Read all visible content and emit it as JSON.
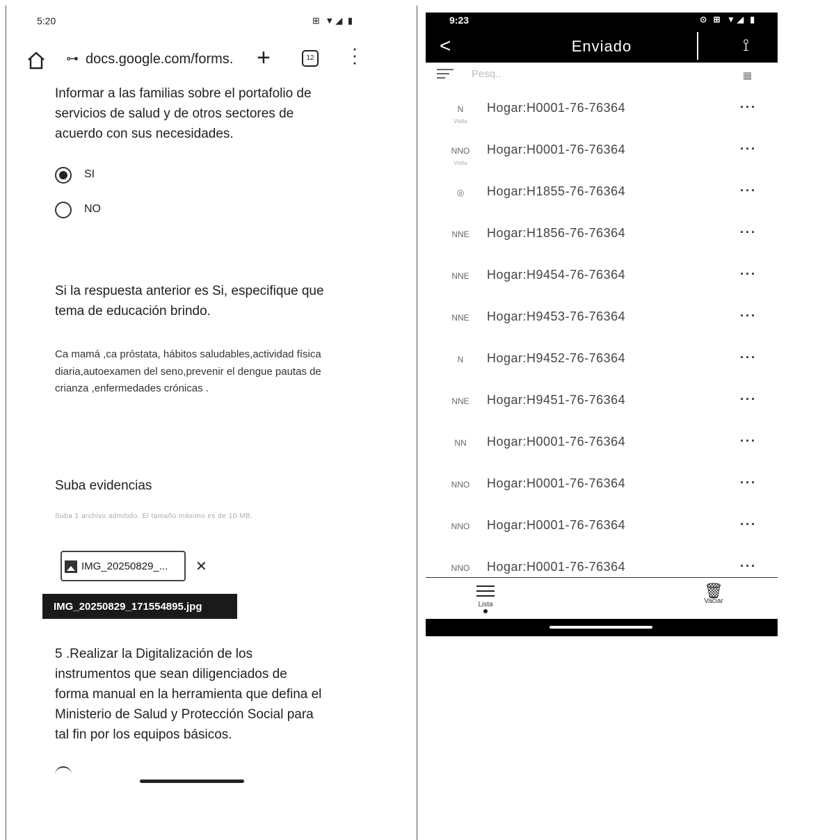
{
  "left_phone": {
    "status": {
      "time": "5:20",
      "icons": "⊞ ▼◢ ▮"
    },
    "browser": {
      "url": "docs.google.com/forms.",
      "tab_count": "12",
      "tune_glyph": "⊶"
    },
    "question1": "Informar a las familias sobre el portafolio de servicios de salud y de otros sectores de acuerdo con sus necesidades.",
    "options": [
      {
        "label": "SI",
        "checked": true
      },
      {
        "label": "NO",
        "checked": false
      }
    ],
    "question2": "Si la respuesta anterior es Si,  especifique que tema de educación brindo.",
    "answer2": "Ca mamá ,ca próstata, hábitos saludables,actividad física diaria,autoexamen del seno,prevenir el dengue pautas de crianza ,enfermedades crónicas .",
    "upload_title": "Suba evidencias",
    "upload_hint": "Suba 1 archivo admitido. El tamaño máximo es de 10 MB.",
    "file_chip": "IMG_20250829_...",
    "file_tooltip": "IMG_20250829_171554895.jpg",
    "remove_glyph": "✕",
    "question5": "5 .Realizar la Digitalización de los instrumentos que sean diligenciados de forma manual en la herramienta que defina el Ministerio de Salud y Protección Social para tal fin por los equipos básicos."
  },
  "right_phone": {
    "status": {
      "time": "9:23",
      "icons": "⊙ ⊞ ▼◢ ▮"
    },
    "header": {
      "back": "<",
      "title": "Enviado",
      "sync_icon": "⟟"
    },
    "toolbar": {
      "search_placeholder": "Pesq..",
      "qr": "▦"
    },
    "items": [
      {
        "code": "N",
        "sub": "Visita",
        "label": "Hogar:H0001-76-76364",
        "more": "···"
      },
      {
        "code": "NNO",
        "sub": "Visita",
        "label": "Hogar:H0001-76-76364",
        "more": "···"
      },
      {
        "code": "◎",
        "sub": "",
        "label": "Hogar:H1855-76-76364",
        "more": "···"
      },
      {
        "code": "NNE",
        "sub": "",
        "label": "Hogar:H1856-76-76364",
        "more": "···"
      },
      {
        "code": "NNE",
        "sub": "",
        "label": "Hogar:H9454-76-76364",
        "more": "···"
      },
      {
        "code": "NNE",
        "sub": "",
        "label": "Hogar:H9453-76-76364",
        "more": "···"
      },
      {
        "code": "N",
        "sub": "",
        "label": "Hogar:H9452-76-76364",
        "more": "···"
      },
      {
        "code": "NNE",
        "sub": "",
        "label": "Hogar:H9451-76-76364",
        "more": "···"
      },
      {
        "code": "NN",
        "sub": "",
        "label": "Hogar:H0001-76-76364",
        "more": "···"
      },
      {
        "code": "NNO",
        "sub": "",
        "label": "Hogar:H0001-76-76364",
        "more": "···"
      },
      {
        "code": "NNO",
        "sub": "",
        "label": "Hogar:H0001-76-76364",
        "more": "···"
      },
      {
        "code": "NNO",
        "sub": "",
        "label": "Hogar:H0001-76-76364",
        "more": "···"
      }
    ],
    "bottom_nav": {
      "lista": "Lista",
      "vaciar": "Vaciar",
      "trash_glyph": "🗑"
    }
  }
}
